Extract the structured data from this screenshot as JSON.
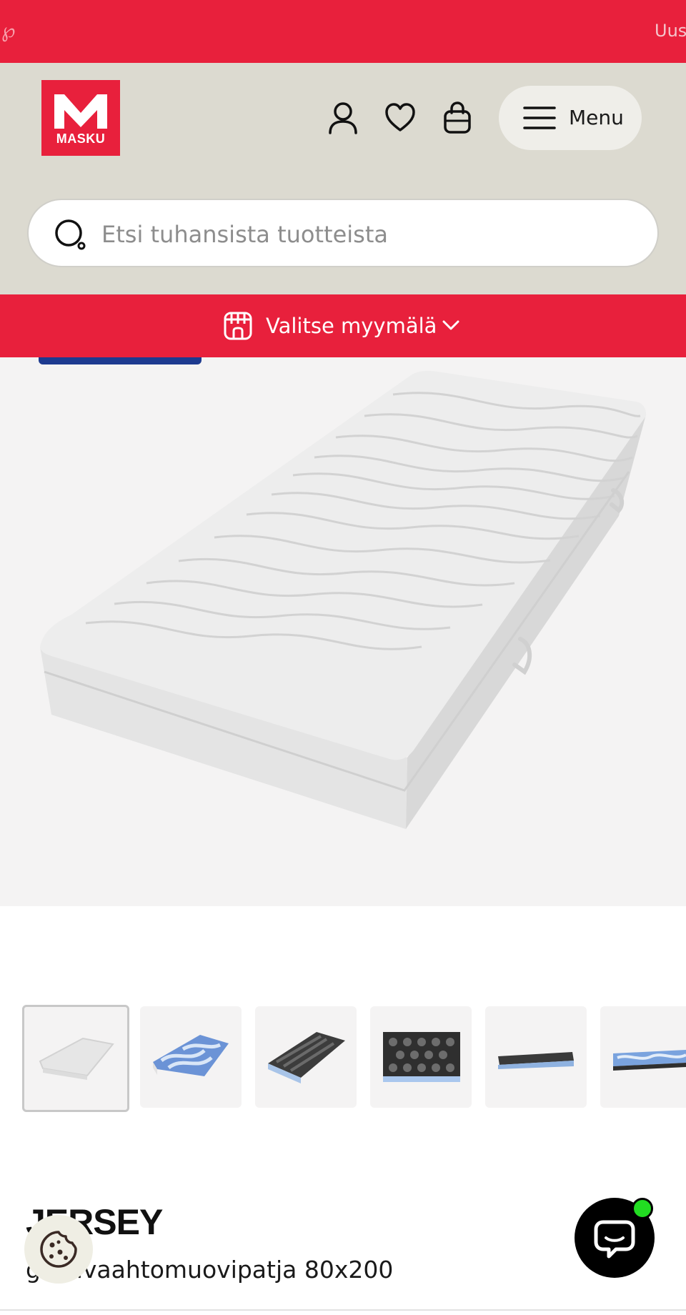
{
  "promo": {
    "text": "Uus",
    "icon": "pinterest-icon"
  },
  "header": {
    "logo_text": "MASKU",
    "icons": [
      "account-icon",
      "heart-icon",
      "bag-icon"
    ],
    "menu_label": "Menu"
  },
  "search": {
    "placeholder": "Etsi tuhansista tuotteista"
  },
  "store": {
    "label": "Valitse myymälä",
    "icon": "store-icon"
  },
  "colors": {
    "brand_red": "#e8203c",
    "header_beige": "#dcdad0",
    "badge_blue": "#1d3a8f",
    "chat_dot_green": "#22dd22"
  },
  "gallery": {
    "thumbnails": [
      "mattress-white",
      "mattress-layers-blue",
      "mattress-foam-black",
      "foam-closeup",
      "mattress-side-dark",
      "mattress-side-blue"
    ],
    "selected_index": 0
  },
  "product": {
    "title": "JERSEY",
    "subtitle": "geelivaahtomuovipatja 80x200"
  }
}
